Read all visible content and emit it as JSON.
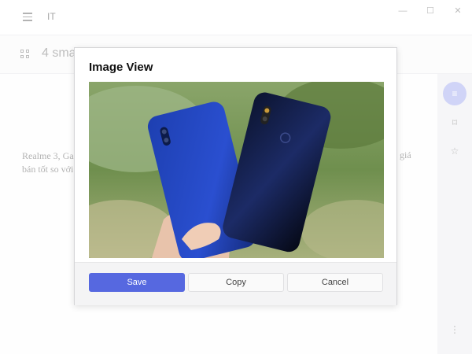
{
  "window": {
    "app_title": "IT",
    "minimize": "—",
    "maximize": "☐",
    "close": "✕"
  },
  "article": {
    "title": "4 sma",
    "body_line1": "Realme 3, Ga",
    "body_line2": "bán tốt so với",
    "body_tail": "giá"
  },
  "rail": {
    "items": [
      {
        "icon": "list-icon",
        "glyph": "≡"
      },
      {
        "icon": "bookmark-icon",
        "glyph": "⌑"
      },
      {
        "icon": "star-icon",
        "glyph": "☆"
      },
      {
        "icon": "more-icon",
        "glyph": "⋮"
      }
    ]
  },
  "modal": {
    "title": "Image View",
    "save_label": "Save",
    "copy_label": "Copy",
    "cancel_label": "Cancel"
  },
  "colors": {
    "accent": "#5668e0",
    "rail_active": "#b7bdf3"
  }
}
